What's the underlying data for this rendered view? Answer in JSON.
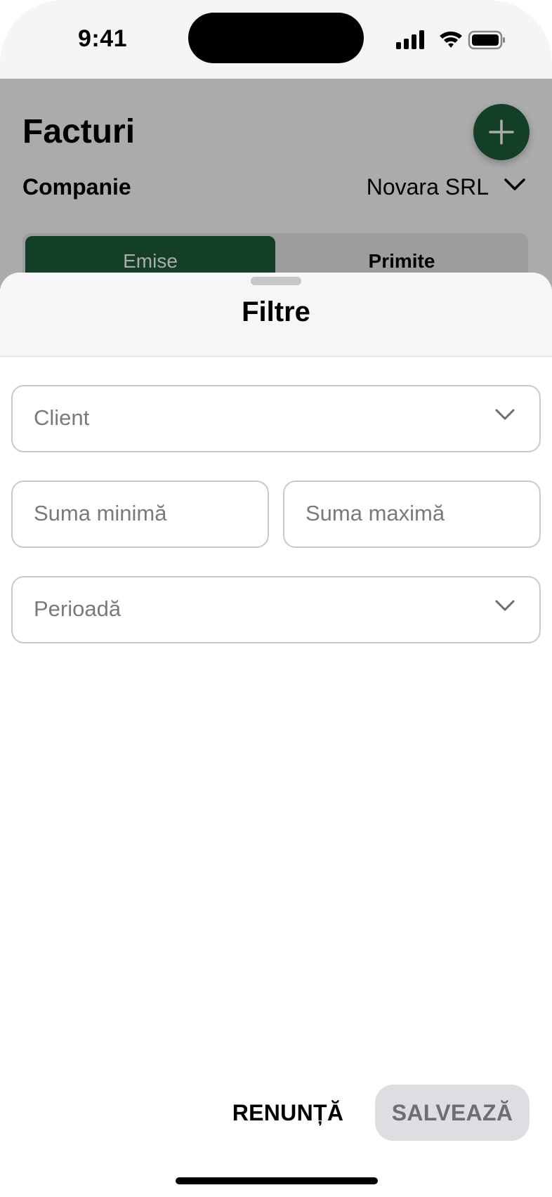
{
  "status_bar": {
    "time": "9:41"
  },
  "background_screen": {
    "title": "Facturi",
    "add_button_icon": "plus-icon",
    "company_label": "Companie",
    "company_value": "Novara SRL",
    "tabs": [
      {
        "label": "Emise",
        "selected": true
      },
      {
        "label": "Primite",
        "selected": false
      }
    ]
  },
  "sheet": {
    "title": "Filtre",
    "fields": {
      "client_placeholder": "Client",
      "min_amount_placeholder": "Suma minimă",
      "max_amount_placeholder": "Suma maximă",
      "period_placeholder": "Perioadă"
    },
    "actions": {
      "cancel_label": "RENUNȚĂ",
      "save_label": "SALVEAZĂ"
    }
  },
  "colors": {
    "accent": "#1b5e3a",
    "disabled_button_bg": "#dedee2",
    "disabled_button_text": "#6d6d72"
  }
}
